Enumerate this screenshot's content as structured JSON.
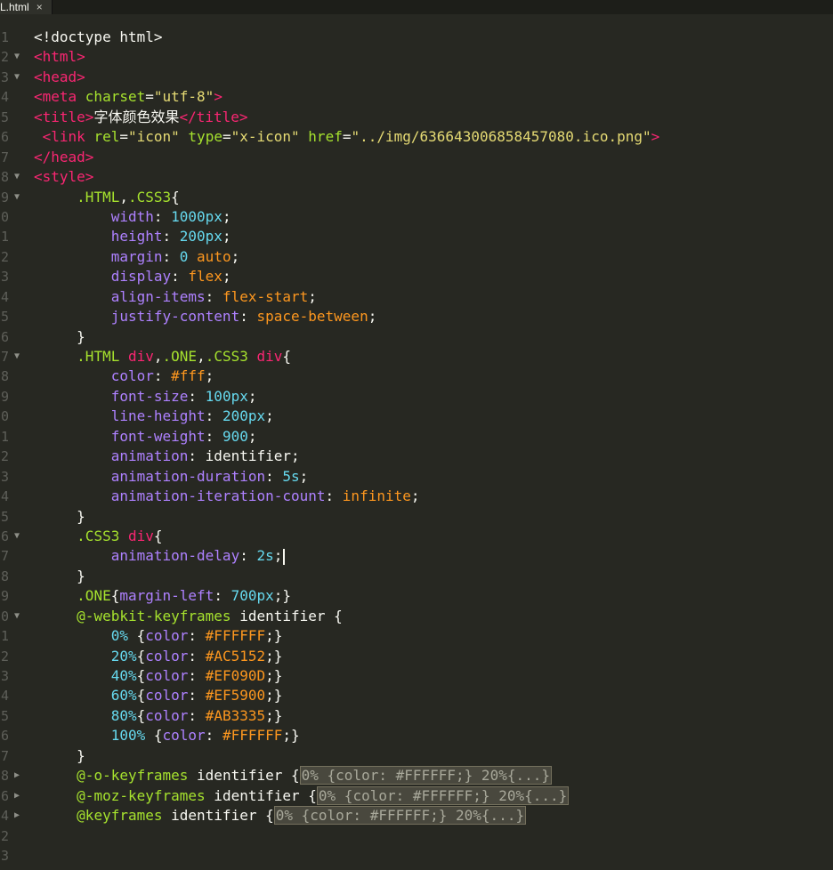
{
  "tab": {
    "label": "L.html",
    "close": "×"
  },
  "gutter": [
    {
      "n": "1",
      "fold": ""
    },
    {
      "n": "2",
      "fold": "▼"
    },
    {
      "n": "3",
      "fold": "▼"
    },
    {
      "n": "4",
      "fold": ""
    },
    {
      "n": "5",
      "fold": ""
    },
    {
      "n": "6",
      "fold": ""
    },
    {
      "n": "7",
      "fold": ""
    },
    {
      "n": "8",
      "fold": "▼"
    },
    {
      "n": "9",
      "fold": "▼"
    },
    {
      "n": "0",
      "fold": ""
    },
    {
      "n": "1",
      "fold": ""
    },
    {
      "n": "2",
      "fold": ""
    },
    {
      "n": "3",
      "fold": ""
    },
    {
      "n": "4",
      "fold": ""
    },
    {
      "n": "5",
      "fold": ""
    },
    {
      "n": "6",
      "fold": ""
    },
    {
      "n": "7",
      "fold": "▼"
    },
    {
      "n": "8",
      "fold": ""
    },
    {
      "n": "9",
      "fold": ""
    },
    {
      "n": "0",
      "fold": ""
    },
    {
      "n": "1",
      "fold": ""
    },
    {
      "n": "2",
      "fold": ""
    },
    {
      "n": "3",
      "fold": ""
    },
    {
      "n": "4",
      "fold": ""
    },
    {
      "n": "5",
      "fold": ""
    },
    {
      "n": "6",
      "fold": "▼"
    },
    {
      "n": "7",
      "fold": ""
    },
    {
      "n": "8",
      "fold": ""
    },
    {
      "n": "9",
      "fold": ""
    },
    {
      "n": "0",
      "fold": "▼"
    },
    {
      "n": "1",
      "fold": ""
    },
    {
      "n": "2",
      "fold": ""
    },
    {
      "n": "3",
      "fold": ""
    },
    {
      "n": "4",
      "fold": ""
    },
    {
      "n": "5",
      "fold": ""
    },
    {
      "n": "6",
      "fold": ""
    },
    {
      "n": "7",
      "fold": ""
    },
    {
      "n": "8",
      "fold": "▶"
    },
    {
      "n": "6",
      "fold": "▶"
    },
    {
      "n": "4",
      "fold": "▶"
    },
    {
      "n": "2",
      "fold": ""
    },
    {
      "n": "3",
      "fold": ""
    }
  ],
  "code_lines": [
    [
      [
        "w",
        "<!doctype html>"
      ]
    ],
    [
      [
        "pk",
        "<html>"
      ]
    ],
    [
      [
        "pk",
        "<head>"
      ]
    ],
    [
      [
        "pk",
        "<meta "
      ],
      [
        "tag",
        "charset"
      ],
      [
        "w",
        "="
      ],
      [
        "str",
        "\"utf-8\""
      ],
      [
        "pk",
        ">"
      ]
    ],
    [
      [
        "pk",
        "<title>"
      ],
      [
        "w",
        "字体颜色效果"
      ],
      [
        "pk",
        "</title>"
      ]
    ],
    [
      [
        "w",
        " "
      ],
      [
        "pk",
        "<link "
      ],
      [
        "tag",
        "rel"
      ],
      [
        "w",
        "="
      ],
      [
        "str",
        "\"icon\""
      ],
      [
        "w",
        " "
      ],
      [
        "tag",
        "type"
      ],
      [
        "w",
        "="
      ],
      [
        "str",
        "\"x-icon\""
      ],
      [
        "w",
        " "
      ],
      [
        "tag",
        "href"
      ],
      [
        "w",
        "="
      ],
      [
        "str",
        "\"../img/636643006858457080.ico.png\""
      ],
      [
        "pk",
        ">"
      ]
    ],
    [
      [
        "pk",
        "</head>"
      ]
    ],
    [
      [
        "pk",
        "<style>"
      ]
    ],
    [
      [
        "w",
        "     "
      ],
      [
        "sel",
        ".HTML"
      ],
      [
        "w",
        ","
      ],
      [
        "sel",
        ".CSS3"
      ],
      [
        "w",
        "{"
      ]
    ],
    [
      [
        "w",
        "         "
      ],
      [
        "prop",
        "width"
      ],
      [
        "w",
        ": "
      ],
      [
        "num",
        "1000px"
      ],
      [
        "w",
        ";"
      ]
    ],
    [
      [
        "w",
        "         "
      ],
      [
        "prop",
        "height"
      ],
      [
        "w",
        ": "
      ],
      [
        "num",
        "200px"
      ],
      [
        "w",
        ";"
      ]
    ],
    [
      [
        "w",
        "         "
      ],
      [
        "prop",
        "margin"
      ],
      [
        "w",
        ": "
      ],
      [
        "num",
        "0"
      ],
      [
        "w",
        " "
      ],
      [
        "val",
        "auto"
      ],
      [
        "w",
        ";"
      ]
    ],
    [
      [
        "w",
        "         "
      ],
      [
        "prop",
        "display"
      ],
      [
        "w",
        ": "
      ],
      [
        "val",
        "flex"
      ],
      [
        "w",
        ";"
      ]
    ],
    [
      [
        "w",
        "         "
      ],
      [
        "prop",
        "align-items"
      ],
      [
        "w",
        ": "
      ],
      [
        "val",
        "flex-start"
      ],
      [
        "w",
        ";"
      ]
    ],
    [
      [
        "w",
        "         "
      ],
      [
        "prop",
        "justify-content"
      ],
      [
        "w",
        ": "
      ],
      [
        "val",
        "space-between"
      ],
      [
        "w",
        ";"
      ]
    ],
    [
      [
        "w",
        "     }"
      ]
    ],
    [
      [
        "w",
        "     "
      ],
      [
        "sel",
        ".HTML"
      ],
      [
        "w",
        " "
      ],
      [
        "pk",
        "div"
      ],
      [
        "w",
        ","
      ],
      [
        "sel",
        ".ONE"
      ],
      [
        "w",
        ","
      ],
      [
        "sel",
        ".CSS3"
      ],
      [
        "w",
        " "
      ],
      [
        "pk",
        "div"
      ],
      [
        "w",
        "{"
      ]
    ],
    [
      [
        "w",
        "         "
      ],
      [
        "prop",
        "color"
      ],
      [
        "w",
        ": "
      ],
      [
        "val",
        "#fff"
      ],
      [
        "w",
        ";"
      ]
    ],
    [
      [
        "w",
        "         "
      ],
      [
        "prop",
        "font-size"
      ],
      [
        "w",
        ": "
      ],
      [
        "num",
        "100px"
      ],
      [
        "w",
        ";"
      ]
    ],
    [
      [
        "w",
        "         "
      ],
      [
        "prop",
        "line-height"
      ],
      [
        "w",
        ": "
      ],
      [
        "num",
        "200px"
      ],
      [
        "w",
        ";"
      ]
    ],
    [
      [
        "w",
        "         "
      ],
      [
        "prop",
        "font-weight"
      ],
      [
        "w",
        ": "
      ],
      [
        "num",
        "900"
      ],
      [
        "w",
        ";"
      ]
    ],
    [
      [
        "w",
        "         "
      ],
      [
        "prop",
        "animation"
      ],
      [
        "w",
        ": identifier;"
      ]
    ],
    [
      [
        "w",
        "         "
      ],
      [
        "prop",
        "animation-duration"
      ],
      [
        "w",
        ": "
      ],
      [
        "num",
        "5s"
      ],
      [
        "w",
        ";"
      ]
    ],
    [
      [
        "w",
        "         "
      ],
      [
        "prop",
        "animation-iteration-count"
      ],
      [
        "w",
        ": "
      ],
      [
        "val",
        "infinite"
      ],
      [
        "w",
        ";"
      ]
    ],
    [
      [
        "w",
        "     }"
      ]
    ],
    [
      [
        "w",
        "     "
      ],
      [
        "sel",
        ".CSS3"
      ],
      [
        "w",
        " "
      ],
      [
        "pk",
        "div"
      ],
      [
        "w",
        "{"
      ]
    ],
    [
      [
        "w",
        "         "
      ],
      [
        "prop",
        "animation-delay"
      ],
      [
        "w",
        ": "
      ],
      [
        "num",
        "2s"
      ],
      [
        "w",
        ";"
      ],
      [
        "cursor",
        ""
      ]
    ],
    [
      [
        "w",
        "     }"
      ]
    ],
    [
      [
        "w",
        "     "
      ],
      [
        "sel",
        ".ONE"
      ],
      [
        "w",
        "{"
      ],
      [
        "prop",
        "margin-left"
      ],
      [
        "w",
        ": "
      ],
      [
        "num",
        "700px"
      ],
      [
        "w",
        ";}"
      ]
    ],
    [
      [
        "w",
        "     "
      ],
      [
        "at",
        "@-webkit-keyframes"
      ],
      [
        "w",
        " identifier {"
      ]
    ],
    [
      [
        "w",
        "         "
      ],
      [
        "num",
        "0%"
      ],
      [
        "w",
        " {"
      ],
      [
        "prop",
        "color"
      ],
      [
        "w",
        ": "
      ],
      [
        "val",
        "#FFFFFF"
      ],
      [
        "w",
        ";}"
      ]
    ],
    [
      [
        "w",
        "         "
      ],
      [
        "num",
        "20%"
      ],
      [
        "w",
        "{"
      ],
      [
        "prop",
        "color"
      ],
      [
        "w",
        ": "
      ],
      [
        "val",
        "#AC5152"
      ],
      [
        "w",
        ";}"
      ]
    ],
    [
      [
        "w",
        "         "
      ],
      [
        "num",
        "40%"
      ],
      [
        "w",
        "{"
      ],
      [
        "prop",
        "color"
      ],
      [
        "w",
        ": "
      ],
      [
        "val",
        "#EF090D"
      ],
      [
        "w",
        ";}"
      ]
    ],
    [
      [
        "w",
        "         "
      ],
      [
        "num",
        "60%"
      ],
      [
        "w",
        "{"
      ],
      [
        "prop",
        "color"
      ],
      [
        "w",
        ": "
      ],
      [
        "val",
        "#EF5900"
      ],
      [
        "w",
        ";}"
      ]
    ],
    [
      [
        "w",
        "         "
      ],
      [
        "num",
        "80%"
      ],
      [
        "w",
        "{"
      ],
      [
        "prop",
        "color"
      ],
      [
        "w",
        ": "
      ],
      [
        "val",
        "#AB3335"
      ],
      [
        "w",
        ";}"
      ]
    ],
    [
      [
        "w",
        "         "
      ],
      [
        "num",
        "100%"
      ],
      [
        "w",
        " {"
      ],
      [
        "prop",
        "color"
      ],
      [
        "w",
        ": "
      ],
      [
        "val",
        "#FFFFFF"
      ],
      [
        "w",
        ";}"
      ]
    ],
    [
      [
        "w",
        "     }"
      ]
    ],
    [
      [
        "w",
        "     "
      ],
      [
        "at",
        "@-o-keyframes"
      ],
      [
        "w",
        " identifier {"
      ],
      [
        "fold",
        "0% {color: #FFFFFF;} 20%{...}"
      ]
    ],
    [
      [
        "w",
        "     "
      ],
      [
        "at",
        "@-moz-keyframes"
      ],
      [
        "w",
        " identifier {"
      ],
      [
        "fold",
        "0% {color: #FFFFFF;} 20%{...}"
      ]
    ],
    [
      [
        "w",
        "     "
      ],
      [
        "at",
        "@keyframes"
      ],
      [
        "w",
        " identifier {"
      ],
      [
        "fold",
        "0% {color: #FFFFFF;} 20%{...}"
      ]
    ],
    [
      [
        "w",
        ""
      ]
    ],
    [
      [
        "w",
        ""
      ]
    ]
  ],
  "colors": {
    "background": "#272822",
    "keyword": "#f92672",
    "attribute": "#a6e22e",
    "string": "#e6db74",
    "property": "#ae81ff",
    "number": "#66d9ef",
    "value": "#fd971f"
  }
}
